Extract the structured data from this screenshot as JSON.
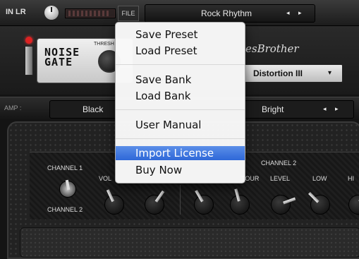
{
  "top_bar": {
    "input_label": "IN LR",
    "file_label": "FILE",
    "preset_name": "Rock Rhythm",
    "arrows": "◂ ▸"
  },
  "gate": {
    "title": "NOISE\nGATE",
    "thresh_label": "THRESH",
    "brand_text": "esBrother",
    "distortion_name": "Distortion III",
    "distortion_caret": "▾"
  },
  "amp_row": {
    "label": "AMP :",
    "left_name": "Black",
    "right_name": "Bright",
    "arrows": "◂ ▸"
  },
  "panel": {
    "channel1": "CHANNEL 1",
    "channel2_lower": "CHANNEL 2",
    "channel2_title": "CHANNEL 2",
    "vol": "VOL",
    "tour": "TOUR",
    "level": "LEVEL",
    "low": "LOW",
    "hi": "HI"
  },
  "file_menu": {
    "items": [
      "Save Preset",
      "Load Preset",
      "Save Bank",
      "Load Bank",
      "User Manual",
      "Import License",
      "Buy Now"
    ],
    "highlight_color": "#3a73dc"
  },
  "colors": {
    "led": "#dd2222",
    "background": "#141414"
  }
}
